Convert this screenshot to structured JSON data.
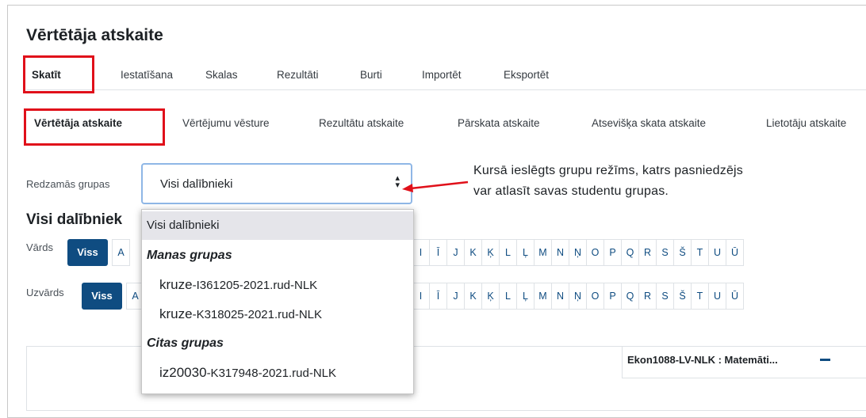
{
  "page_title": "Vērtētāja atskaite",
  "primary_tabs": [
    {
      "label": "Skatīt",
      "active": true
    },
    {
      "label": "Iestatīšana",
      "active": false
    },
    {
      "label": "Skalas",
      "active": false
    },
    {
      "label": "Rezultāti",
      "active": false
    },
    {
      "label": "Burti",
      "active": false
    },
    {
      "label": "Importēt",
      "active": false
    },
    {
      "label": "Eksportēt",
      "active": false
    }
  ],
  "secondary_tabs": [
    {
      "label": "Vērtētāja atskaite",
      "active": true
    },
    {
      "label": "Vērtējumu vēsture",
      "active": false
    },
    {
      "label": "Rezultātu atskaite",
      "active": false
    },
    {
      "label": "Pārskata atskaite",
      "active": false
    },
    {
      "label": "Atsevišķa skata atskaite",
      "active": false
    },
    {
      "label": "Lietotāju atskaite",
      "active": false
    }
  ],
  "group_selector": {
    "label": "Redzamās grupas",
    "selected": "Visi dalībnieki",
    "options": [
      {
        "label": "Visi dalībnieki"
      }
    ],
    "optgroups": [
      {
        "label": "Manas grupas",
        "items": [
          {
            "name": "kruze",
            "suffix": "-I361205-2021.rud-NLK"
          },
          {
            "name": "kruze",
            "suffix": "-K318025-2021.rud-NLK"
          }
        ]
      },
      {
        "label": "Citas grupas",
        "items": [
          {
            "name": "iz20030",
            "suffix": "-K317948-2021.rud-NLK"
          }
        ]
      }
    ]
  },
  "annotation": {
    "line1": "Kursā ieslēgts grupu režīms, katrs pasniedzējs",
    "line2": "var atlasīt savas studentu grupas."
  },
  "participants_heading": "Visi dalībniek",
  "first_name_filter": {
    "label": "Vārds",
    "all_label": "Viss",
    "left_letters": [
      "A"
    ],
    "letters": [
      "I",
      "Ī",
      "J",
      "K",
      "Ķ",
      "L",
      "Ļ",
      "M",
      "N",
      "Ņ",
      "O",
      "P",
      "Q",
      "R",
      "S",
      "Š",
      "T",
      "U",
      "Ū"
    ]
  },
  "last_name_filter": {
    "label": "Uzvārds",
    "all_label": "Viss",
    "left_letters": [
      "A"
    ],
    "letters": [
      "I",
      "Ī",
      "J",
      "K",
      "Ķ",
      "L",
      "Ļ",
      "M",
      "N",
      "Ņ",
      "O",
      "P",
      "Q",
      "R",
      "S",
      "Š",
      "T",
      "U",
      "Ū"
    ]
  },
  "grade_item": {
    "title": "Ekon1088-LV-NLK : Matemāti..."
  },
  "colors": {
    "accent": "#0f4c81",
    "highlight_box": "#e0101a",
    "selected_option_bg": "#e5e5ea"
  }
}
